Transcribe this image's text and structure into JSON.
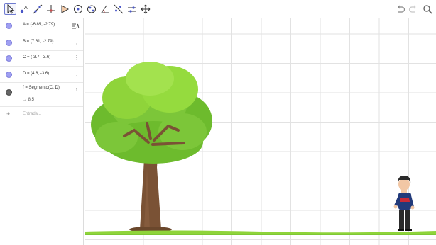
{
  "toolbar": {
    "tools": [
      "move-tool",
      "point-tool",
      "line-tool",
      "perpendicular-tool",
      "polygon-tool",
      "circle-tool",
      "conic-tool",
      "angle-tool",
      "reflect-tool",
      "slider-tool",
      "move-view-tool"
    ],
    "right_icons": [
      "undo-icon",
      "redo-icon",
      "search-icon"
    ]
  },
  "algebra": {
    "rows": [
      {
        "text": "A = (-6.85, -2.79)",
        "kind": "point"
      },
      {
        "text": "B = (7.61, -2.79)",
        "kind": "point"
      },
      {
        "text": "C = (-3.7, -3.6)",
        "kind": "point"
      },
      {
        "text": "D = (4.8, -3.6)",
        "kind": "point"
      },
      {
        "text": "f = Segmento(C, D)",
        "value": "→ 8.5",
        "kind": "segment"
      }
    ],
    "input_placeholder": "Entrada...",
    "add_symbol": "+",
    "kebab": "⋮"
  },
  "colors": {
    "accent": "#6f7bd0",
    "point_fill": "#9f9ff2",
    "grass": "#8fd43a",
    "tree_leaves": "#7cc639",
    "trunk": "#7a5235"
  }
}
